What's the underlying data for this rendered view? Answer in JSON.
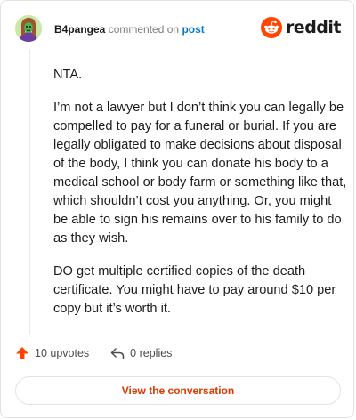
{
  "header": {
    "username": "B4pangea",
    "verb": "commented on",
    "post_link": "post",
    "logo_text": "reddit"
  },
  "comment": {
    "paragraphs": [
      "NTA.",
      "I’m not a lawyer but I don’t think you can legally be compelled to pay for a funeral or burial. If you are legally obligated to make decisions about disposal of the body, I think you can donate his body to a medical school or body farm or something like that, which shouldn’t cost you anything. Or, you might be able to sign his remains over to his family to do as they wish.",
      "DO get multiple certified copies of the death certificate. You might have to pay around $10 per copy but it’s worth it."
    ]
  },
  "actions": {
    "upvotes": "10 upvotes",
    "replies": "0 replies"
  },
  "footer": {
    "view_label": "View the conversation"
  },
  "colors": {
    "upvote": "#ff4500",
    "link": "#0079d3",
    "cta": "#d93a00",
    "avatar_bg": "#c9e7a8"
  },
  "icons": {
    "logo": "reddit-snoo-icon",
    "upvote": "upvote-arrow-icon",
    "reply": "reply-arrow-icon"
  }
}
